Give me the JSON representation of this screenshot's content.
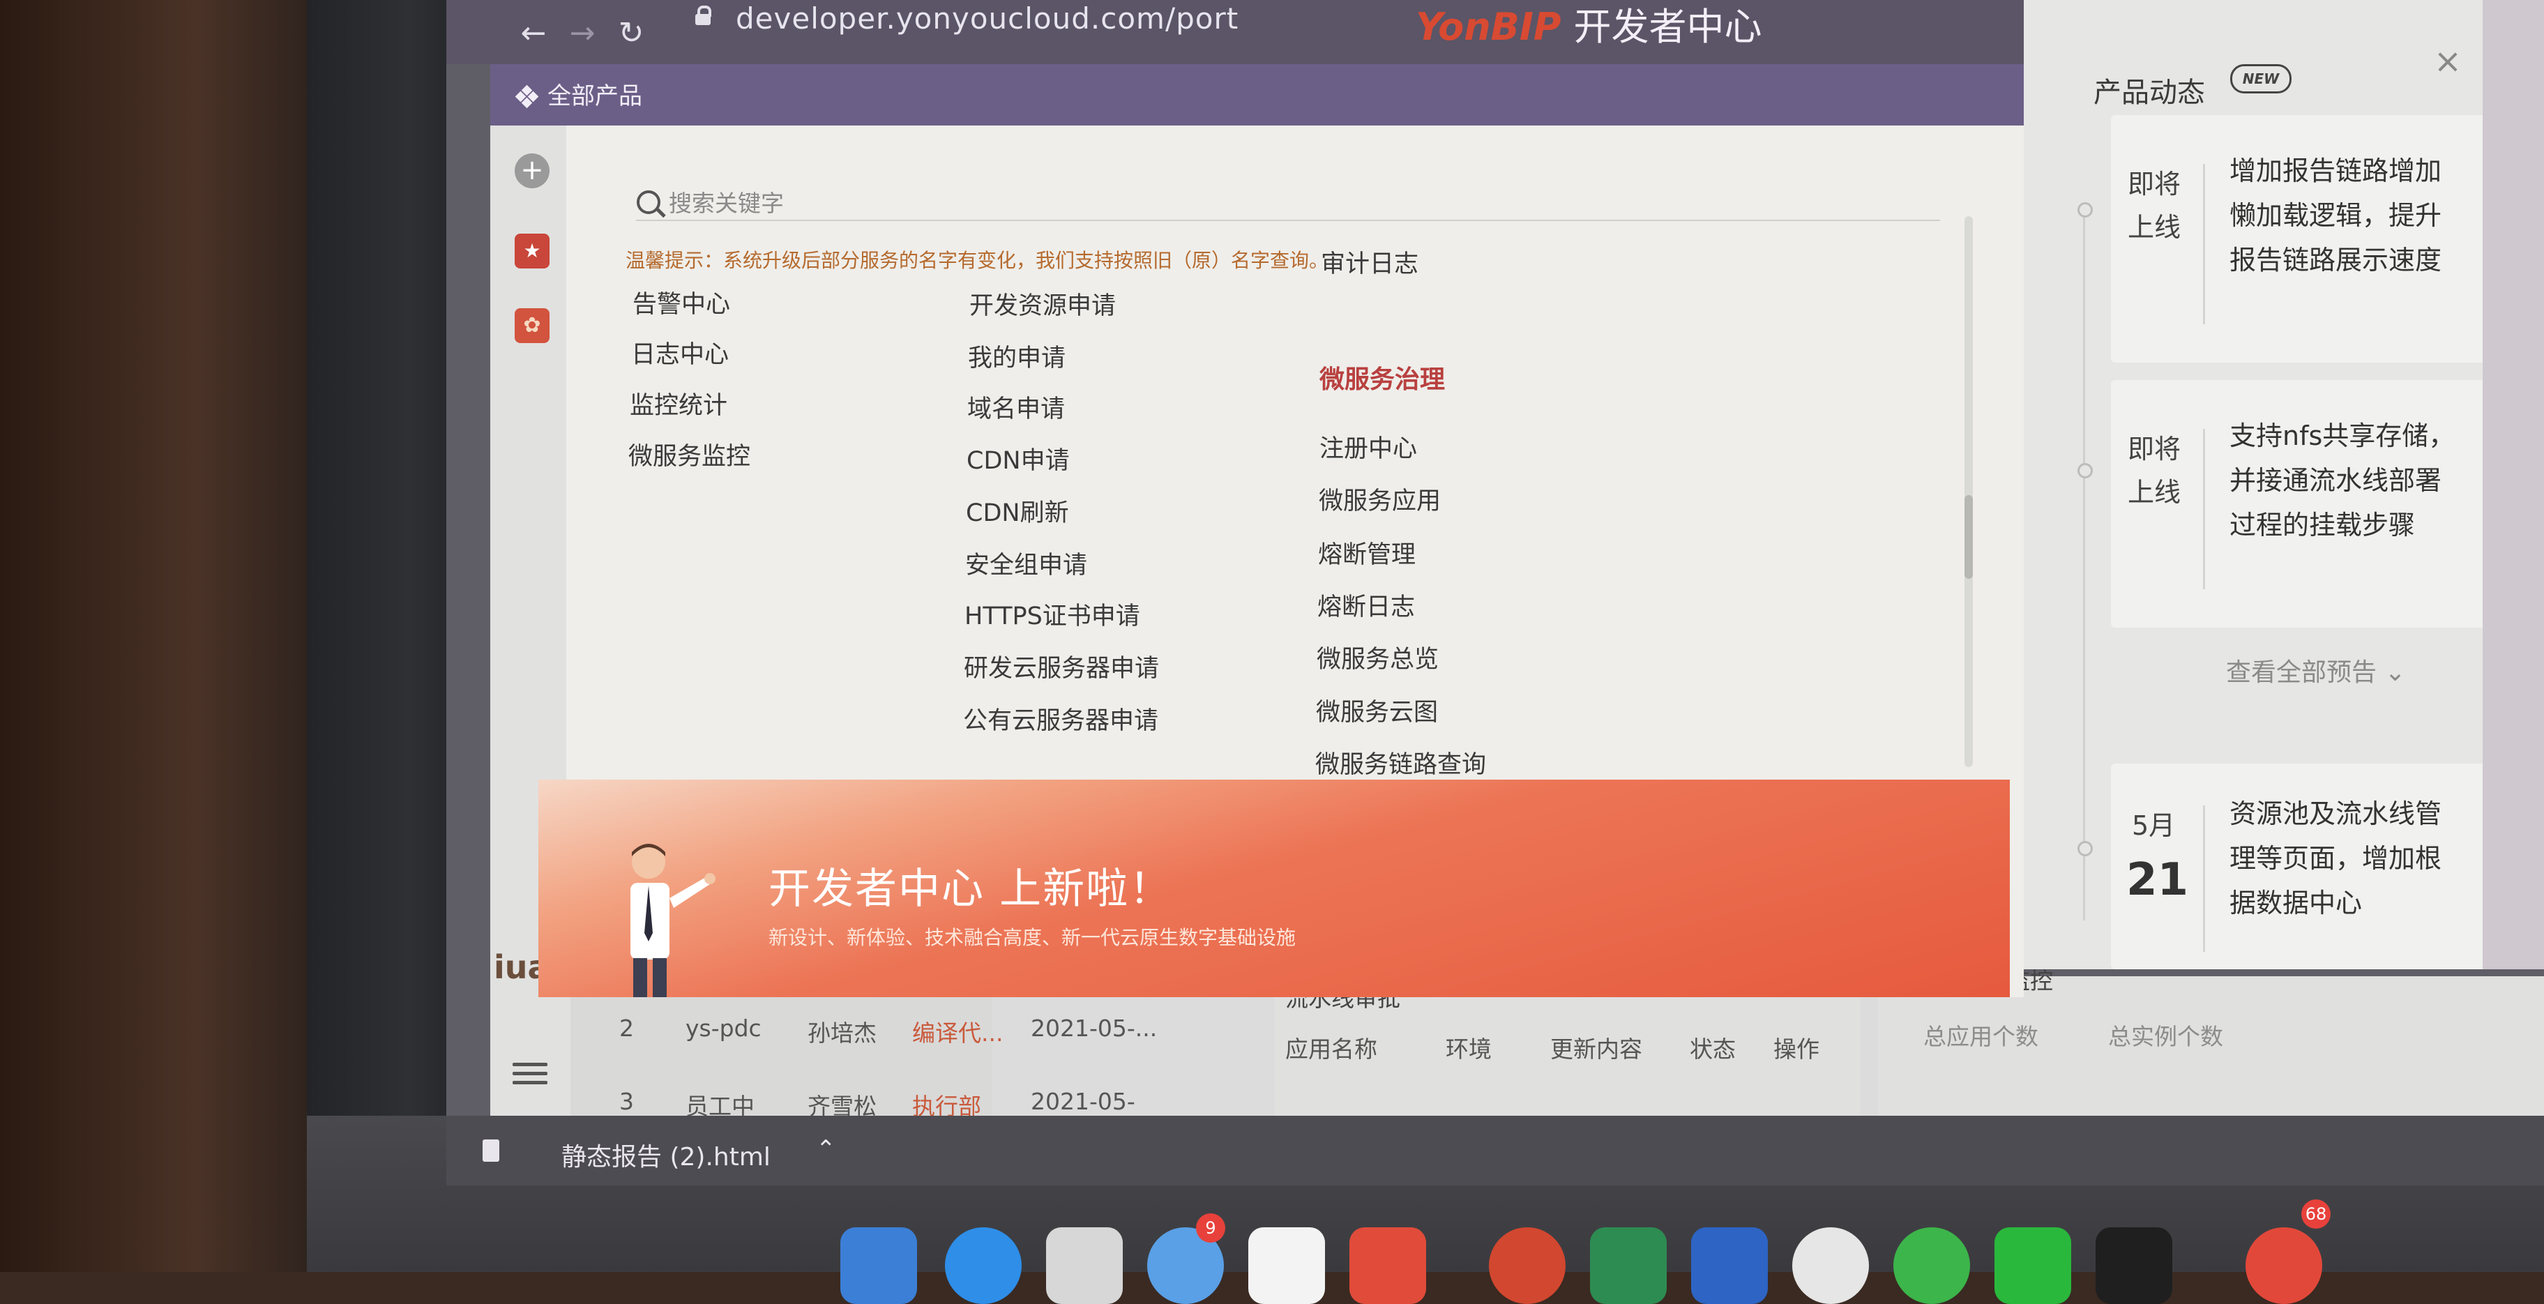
{
  "browser": {
    "url": "developer.yonyoucloud.com/port",
    "brand_logo": "YonBIP",
    "brand_title": "开发者中心"
  },
  "topbar": {
    "all_products": "全部产品"
  },
  "rail": {
    "logo": "iuap"
  },
  "search": {
    "placeholder": "搜索关键字"
  },
  "tip": "温馨提示：系统升级后部分服务的名字有变化，我们支持按照旧（原）名字查询。",
  "columns": {
    "col1": [
      "告警中心",
      "日志中心",
      "监控统计",
      "微服务监控"
    ],
    "col2": [
      "开发资源申请",
      "我的申请",
      "域名申请",
      "CDN申请",
      "CDN刷新",
      "安全组申请",
      "HTTPS证书申请",
      "研发云服务器申请",
      "公有云服务器申请"
    ],
    "col3_top": "审计日志",
    "col3_title": "微服务治理",
    "col3": [
      "注册中心",
      "微服务应用",
      "熔断管理",
      "熔断日志",
      "微服务总览",
      "微服务云图",
      "微服务链路查询"
    ]
  },
  "banner": {
    "title": "开发者中心 上新啦！",
    "subtitle": "新设计、新体验、技术融合高度、新一代云原生数字基础设施"
  },
  "notifications": {
    "title": "产品动态",
    "badge": "NEW",
    "view_all": "查看全部预告",
    "items": [
      {
        "tag": "即将上线",
        "text": "增加报告链路增加懒加载逻辑，提升报告链路展示速度"
      },
      {
        "tag": "即将上线",
        "text": "支持nfs共享存储，并接通流水线部署过程的挂载步骤"
      },
      {
        "month": "5月",
        "day": "21",
        "text": "资源池及流水线管理等页面，增加根据数据中心"
      }
    ]
  },
  "bg_app": {
    "rows": [
      [
        "2",
        "ys-pdc",
        "孙培杰",
        "编译代...",
        "2021-05-..."
      ],
      [
        "3",
        "员工中",
        "齐雪松",
        "执行部",
        "2021-05-"
      ]
    ],
    "pipeline_title": "流水线审批",
    "pipeline_headers": [
      "应用名称",
      "环境",
      "更新内容",
      "状态",
      "操作"
    ],
    "monitor_title": "微服务应用监控",
    "monitor_headers": [
      "总应用个数",
      "总实例个数"
    ]
  },
  "download": {
    "filename": "静态报告 (2).html"
  },
  "dock_badges": [
    "9",
    "68"
  ]
}
